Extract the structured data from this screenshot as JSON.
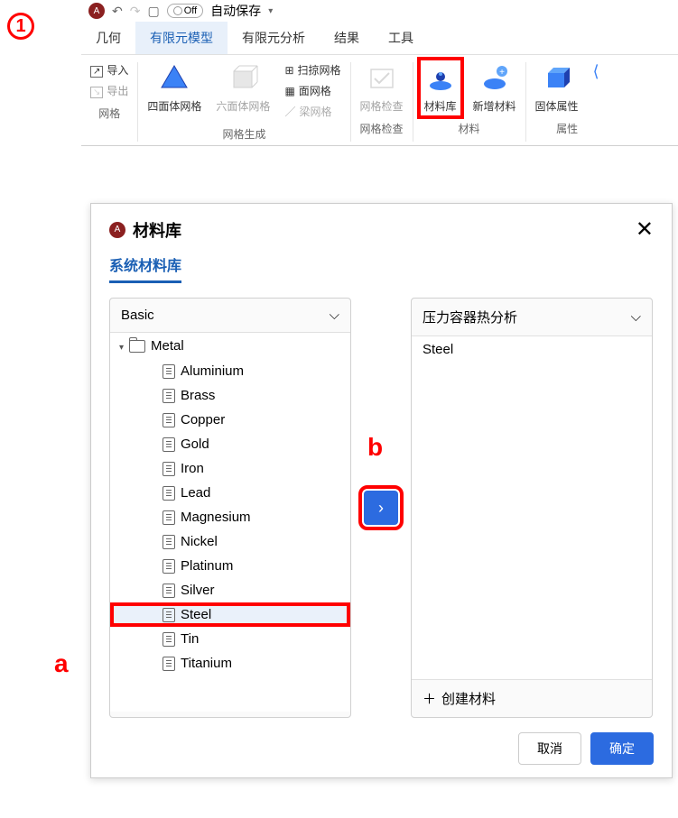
{
  "toolbar": {
    "toggle_label": "Off",
    "autosave_label": "自动保存"
  },
  "menu": {
    "items": [
      "几何",
      "有限元模型",
      "有限元分析",
      "结果",
      "工具"
    ],
    "active_index": 1
  },
  "ribbon": {
    "groups": [
      {
        "label": "网格",
        "small_items": [
          {
            "name": "import",
            "label": "导入"
          },
          {
            "name": "export",
            "label": "导出"
          }
        ]
      },
      {
        "label": "网格生成",
        "items": [
          {
            "name": "tetra-mesh",
            "label": "四面体网格"
          },
          {
            "name": "hexa-mesh",
            "label": "六面体网格",
            "disabled": true
          }
        ],
        "small_items": [
          {
            "name": "sweep-mesh",
            "label": "扫掠网格"
          },
          {
            "name": "surface-mesh",
            "label": "面网格"
          },
          {
            "name": "beam-mesh",
            "label": "梁网格",
            "disabled": true
          }
        ]
      },
      {
        "label": "网格检查",
        "items": [
          {
            "name": "mesh-check",
            "label": "网格检查",
            "disabled": true
          }
        ]
      },
      {
        "label": "材料",
        "items": [
          {
            "name": "material-lib",
            "label": "材料库",
            "highlighted": true
          },
          {
            "name": "new-material",
            "label": "新增材料"
          }
        ]
      },
      {
        "label": "属性",
        "items": [
          {
            "name": "solid-prop",
            "label": "固体属性"
          }
        ]
      }
    ]
  },
  "dialog": {
    "title": "材料库",
    "tab": "系统材料库",
    "left": {
      "dropdown": "Basic",
      "root": "Metal",
      "items": [
        "Aluminium",
        "Brass",
        "Copper",
        "Gold",
        "Iron",
        "Lead",
        "Magnesium",
        "Nickel",
        "Platinum",
        "Silver",
        "Steel",
        "Tin",
        "Titanium"
      ],
      "selected_index": 10
    },
    "right": {
      "dropdown": "压力容器热分析",
      "items": [
        "Steel"
      ],
      "create_label": "创建材料"
    },
    "cancel_label": "取消",
    "ok_label": "确定"
  },
  "annotations": {
    "step1": "1",
    "a": "a",
    "b": "b"
  }
}
